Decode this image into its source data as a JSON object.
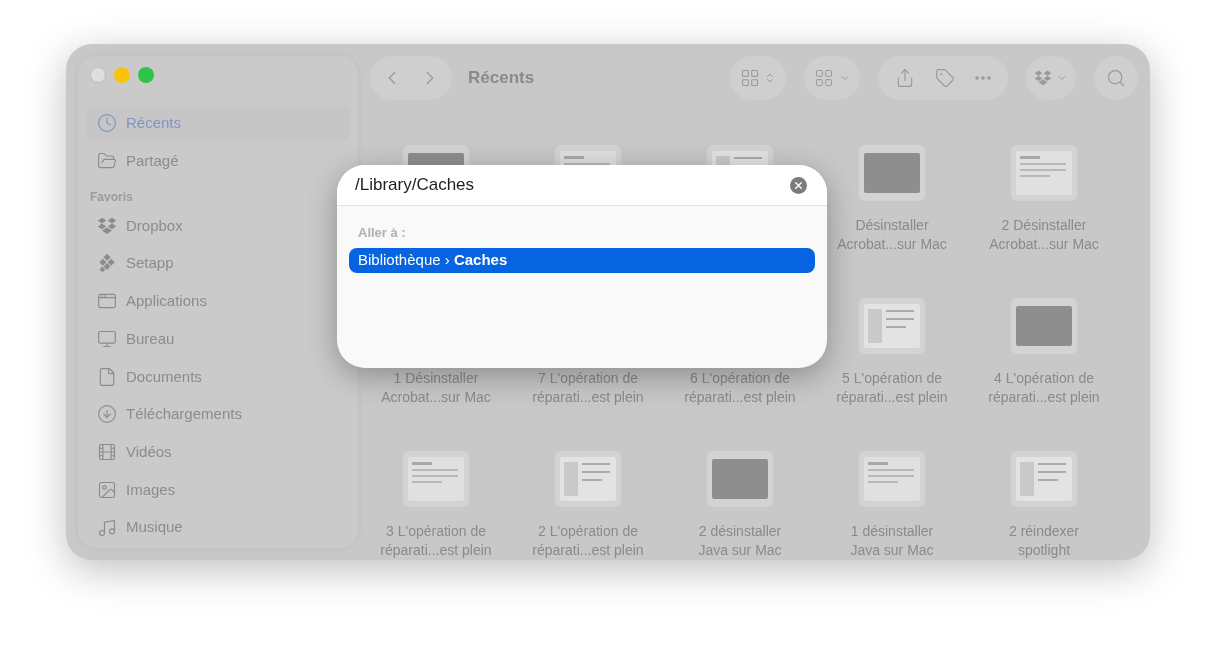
{
  "window": {
    "title": "Récents"
  },
  "sidebar": {
    "items": [
      {
        "label": "Récents",
        "selected": true
      },
      {
        "label": "Partagé",
        "selected": false
      }
    ],
    "section": "Favoris",
    "favorites": [
      {
        "label": "Dropbox",
        "selected": false
      },
      {
        "label": "Setapp",
        "selected": false
      },
      {
        "label": "Applications",
        "selected": false
      },
      {
        "label": "Bureau",
        "selected": false
      },
      {
        "label": "Documents",
        "selected": false
      },
      {
        "label": "Téléchargements",
        "selected": false
      },
      {
        "label": "Vidéos",
        "selected": false
      },
      {
        "label": "Images",
        "selected": false
      },
      {
        "label": "Musique",
        "selected": false
      }
    ]
  },
  "grid": {
    "rows": [
      [
        {
          "kind": "picture"
        },
        {
          "kind": "picture"
        },
        {
          "kind": "picture"
        },
        {
          "kind": "picture",
          "lines": [
            "Désinstaller",
            "Acrobat...sur Mac"
          ]
        },
        {
          "kind": "picture",
          "lines": [
            "2 Désinstaller",
            "Acrobat...sur Mac"
          ]
        }
      ],
      [
        {
          "lines": [
            "1 Désinstaller",
            "Acrobat...sur Mac"
          ]
        },
        {
          "lines": [
            "7 L'opération de",
            "réparati...est plein"
          ]
        },
        {
          "lines": [
            "6 L'opération de",
            "réparati...est plein"
          ]
        },
        {
          "kind": "picture",
          "lines": [
            "5 L'opération de",
            "réparati...est plein"
          ]
        },
        {
          "kind": "picture",
          "lines": [
            "4 L'opération de",
            "réparati...est plein"
          ]
        }
      ],
      [
        {
          "kind": "picture",
          "lines": [
            "3 L'opération de",
            "réparati...est plein"
          ]
        },
        {
          "kind": "picture",
          "lines": [
            "2 L'opération de",
            "réparati...est plein"
          ]
        },
        {
          "kind": "picture",
          "lines": [
            "2 désinstaller",
            "Java sur Mac"
          ]
        },
        {
          "kind": "picture",
          "lines": [
            "1 désinstaller",
            "Java sur Mac"
          ]
        },
        {
          "kind": "picture",
          "lines": [
            "2 réindexer",
            "spotlight"
          ]
        }
      ]
    ]
  },
  "dialog": {
    "path_field": {
      "value": "/Library/Caches"
    },
    "section_label": "Aller à :",
    "results": [
      {
        "text": "Bibliothèque › **Caches**",
        "selected": true
      }
    ]
  }
}
